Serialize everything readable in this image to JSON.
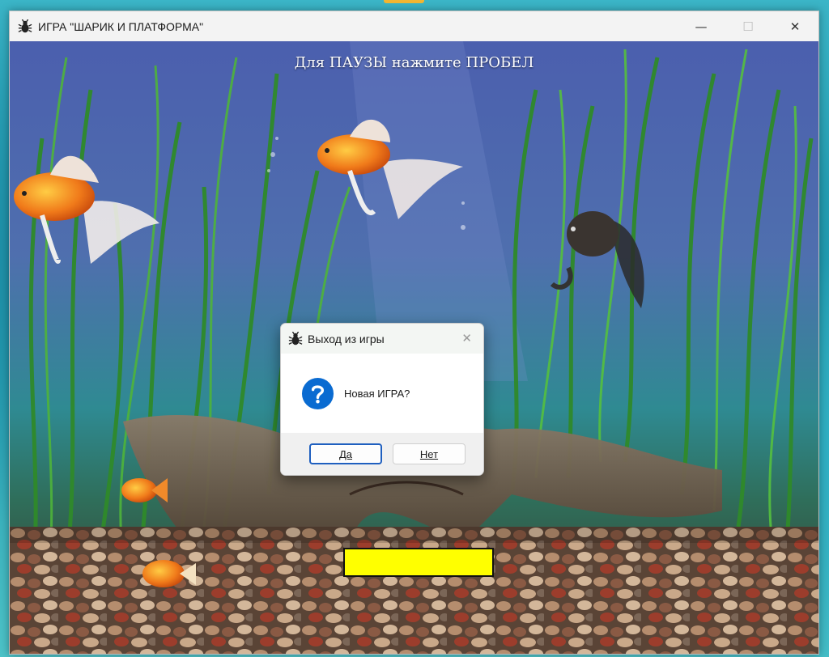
{
  "window": {
    "title": "ИГРА \"ШАРИК И ПЛАТФОРМА\"",
    "controls": {
      "minimize": "—",
      "maximize": "☐",
      "close": "✕"
    }
  },
  "game": {
    "hint": "Для ПАУЗЫ нажмите ПРОБЕЛ",
    "platform_color": "#ffff00",
    "background": "aquarium with goldfish, water plants, driftwood and pebbles"
  },
  "dialog": {
    "title": "Выход из игры",
    "message": "Новая ИГРА?",
    "icon": "question-icon",
    "close": "✕",
    "buttons": {
      "yes": "Да",
      "no": "Нет"
    }
  },
  "colors": {
    "accent": "#1f5fbf",
    "question_icon": "#0a6bd1"
  }
}
